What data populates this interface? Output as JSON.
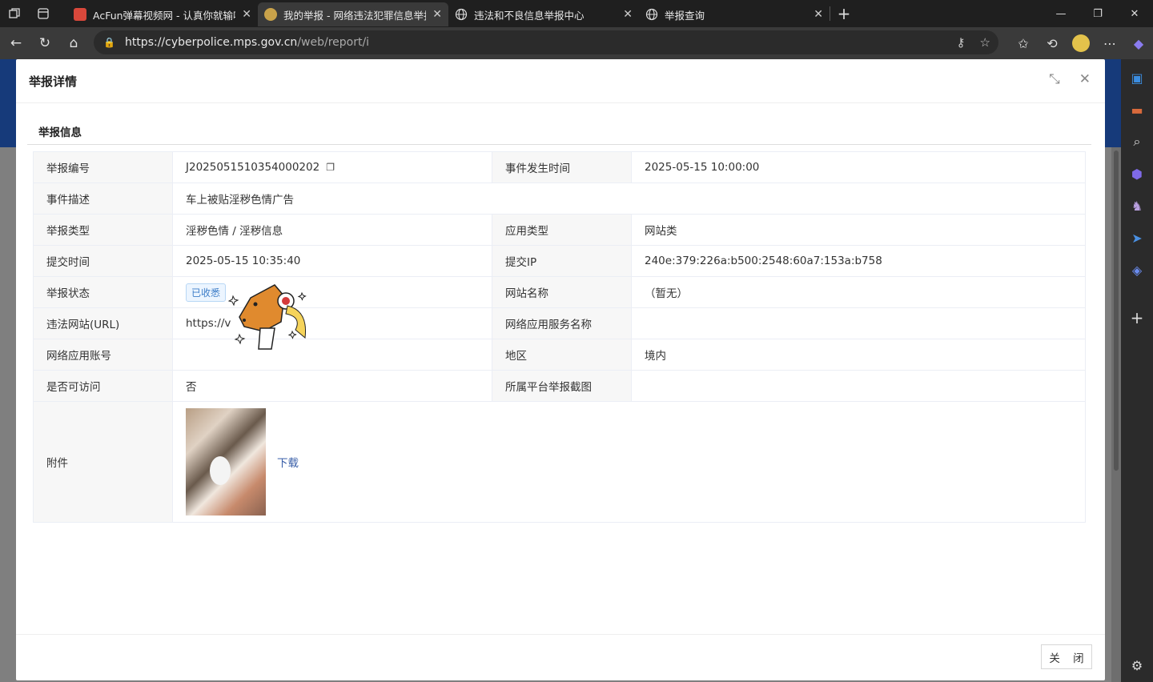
{
  "browser": {
    "tabs": [
      {
        "title": "AcFun弹幕视频网 - 认真你就输啦",
        "active": false
      },
      {
        "title": "我的举报 - 网络违法犯罪信息举报",
        "active": true
      },
      {
        "title": "违法和不良信息举报中心",
        "active": false
      },
      {
        "title": "举报查询",
        "active": false
      }
    ],
    "url_host": "https://cyberpolice.mps.gov.cn",
    "url_path": "/web/report/i"
  },
  "modal": {
    "title": "举报详情",
    "section_title": "举报信息",
    "close_label": "关 闭",
    "rows": {
      "report_no_label": "举报编号",
      "report_no": "J2025051510354000202",
      "event_time_label": "事件发生时间",
      "event_time": "2025-05-15 10:00:00",
      "desc_label": "事件描述",
      "desc": "车上被贴淫秽色情广告",
      "type_label": "举报类型",
      "type": "淫秽色情 / 淫秽信息",
      "app_type_label": "应用类型",
      "app_type": "网站类",
      "submit_time_label": "提交时间",
      "submit_time": "2025-05-15 10:35:40",
      "submit_ip_label": "提交IP",
      "submit_ip": "240e:379:226a:b500:2548:60a7:153a:b758",
      "status_label": "举报状态",
      "status": "已收悉",
      "site_name_label": "网站名称",
      "site_name": "（暂无）",
      "url_label": "违法网站(URL)",
      "url": "https://v",
      "service_name_label": "网络应用服务名称",
      "service_name": "",
      "account_label": "网络应用账号",
      "account": "",
      "region_label": "地区",
      "region": "境内",
      "accessible_label": "是否可访问",
      "accessible": "否",
      "platform_shot_label": "所属平台举报截图",
      "platform_shot": "",
      "attach_label": "附件",
      "download": "下载"
    }
  }
}
